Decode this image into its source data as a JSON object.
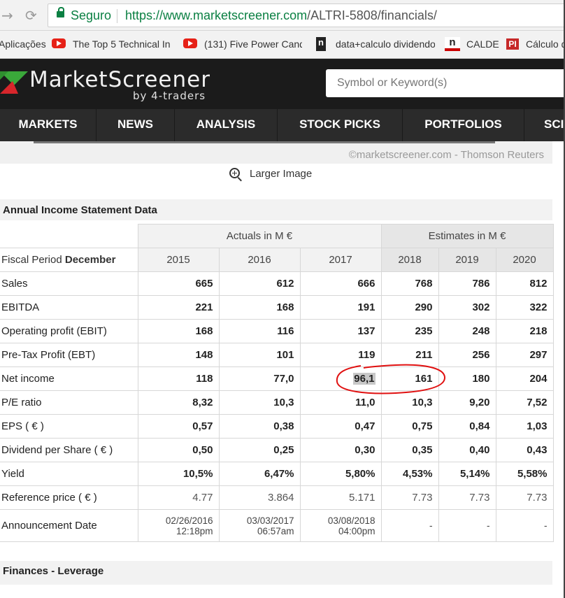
{
  "browser": {
    "secure_label": "Seguro",
    "url_host": "https://www.marketscreener.com",
    "url_path": "/ALTRI-5808/financials/"
  },
  "bookmarks": [
    {
      "label": "Aplicações"
    },
    {
      "label": "The Top 5 Technical In",
      "icon": "youtube-icon"
    },
    {
      "label": "(131) Five Power Cand",
      "icon": "youtube-icon"
    },
    {
      "label": "data+calculo dividendo",
      "icon": "n-logo-icon"
    },
    {
      "label": "CALDE",
      "icon": "n-logo-icon"
    },
    {
      "label": "Cálculo d",
      "icon": "pi-logo-icon"
    }
  ],
  "site": {
    "logo_text": "MarketScreener",
    "logo_sub": "by 4-traders",
    "search_placeholder": "Symbol or Keyword(s)",
    "nav": [
      "MARKETS",
      "NEWS",
      "ANALYSIS",
      "STOCK PICKS",
      "PORTFOLIOS",
      "SCI"
    ]
  },
  "chart_credit": "©marketscreener.com - Thomson Reuters",
  "larger_image": "Larger Image",
  "income": {
    "title": "Annual Income Statement Data",
    "actuals_label": "Actuals in M €",
    "estimates_label": "Estimates in M €",
    "fiscal_label": "Fiscal Period ",
    "fiscal_month": "December",
    "years": [
      "2015",
      "2016",
      "2017",
      "2018",
      "2019",
      "2020"
    ],
    "rows": [
      {
        "label": "Sales",
        "values": [
          "665",
          "612",
          "666",
          "768",
          "786",
          "812"
        ]
      },
      {
        "label": "EBITDA",
        "values": [
          "221",
          "168",
          "191",
          "290",
          "302",
          "322"
        ]
      },
      {
        "label": "Operating profit (EBIT)",
        "values": [
          "168",
          "116",
          "137",
          "235",
          "248",
          "218"
        ]
      },
      {
        "label": "Pre-Tax Profit (EBT)",
        "values": [
          "148",
          "101",
          "119",
          "211",
          "256",
          "297"
        ]
      },
      {
        "label": "Net income",
        "values": [
          "118",
          "77,0",
          "96,1",
          "161",
          "180",
          "204"
        ]
      },
      {
        "label": "P/E ratio",
        "values": [
          "8,32",
          "10,3",
          "11,0",
          "10,3",
          "9,20",
          "7,52"
        ]
      },
      {
        "label": "EPS ( € )",
        "values": [
          "0,57",
          "0,38",
          "0,47",
          "0,75",
          "0,84",
          "1,03"
        ]
      },
      {
        "label": "Dividend per Share ( € )",
        "values": [
          "0,50",
          "0,25",
          "0,30",
          "0,35",
          "0,40",
          "0,43"
        ]
      },
      {
        "label": "Yield",
        "values": [
          "10,5%",
          "6,47%",
          "5,80%",
          "4,53%",
          "5,14%",
          "5,58%"
        ]
      },
      {
        "label": "Reference price ( € )",
        "values": [
          "4.77",
          "3.864",
          "5.171",
          "7.73",
          "7.73",
          "7.73"
        ]
      }
    ],
    "announcement": {
      "label": "Announcement Date",
      "values": [
        {
          "date": "02/26/2016",
          "time": "12:18pm"
        },
        {
          "date": "03/03/2017",
          "time": "06:57am"
        },
        {
          "date": "03/08/2018",
          "time": "04:00pm"
        },
        {
          "date": "-",
          "time": ""
        },
        {
          "date": "-",
          "time": ""
        },
        {
          "date": "-",
          "time": ""
        }
      ]
    }
  },
  "leverage_title": "Finances - Leverage",
  "colors": {
    "accent_green": "#0b8043",
    "header_bg": "#1b1b1b",
    "annotation_red": "#e01010"
  }
}
